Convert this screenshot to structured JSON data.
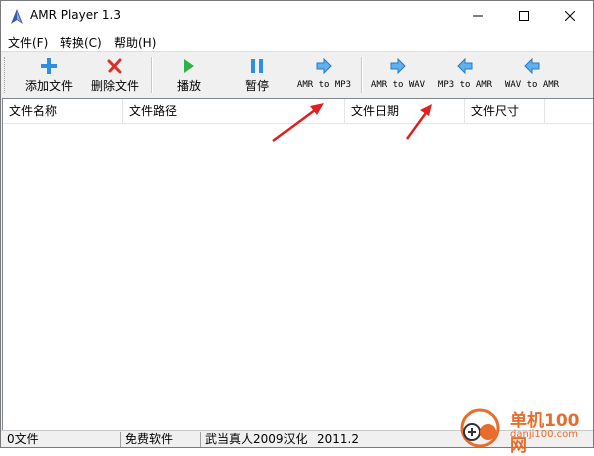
{
  "window": {
    "title": "AMR Player 1.3"
  },
  "menu": [
    {
      "label": "文件(F)"
    },
    {
      "label": "转换(C)"
    },
    {
      "label": "帮助(H)"
    }
  ],
  "toolbar": {
    "add": "添加文件",
    "delete": "删除文件",
    "play": "播放",
    "pause": "暂停",
    "amr_to_mp3": "AMR to MP3",
    "amr_to_wav": "AMR to WAV",
    "mp3_to_amr": "MP3 to AMR",
    "wav_to_amr": "WAV to AMR"
  },
  "columns": [
    "文件名称",
    "文件路径",
    "文件日期",
    "文件尺寸"
  ],
  "files": [],
  "status": {
    "count": "0文件",
    "license": "免费软件",
    "credit": "武当真人2009汉化",
    "version": "2011.2"
  },
  "watermark": {
    "brand": "单机100网",
    "domain": "danji100.com"
  },
  "colors": {
    "annotation_arrow": "#e02020",
    "watermark": "#e86c2b",
    "icon_blue": "#2f8de4",
    "icon_green": "#2bb34a",
    "icon_red": "#d9302a"
  },
  "icons": [
    "app-icon",
    "minimize-icon",
    "maximize-icon",
    "close-icon",
    "plus-icon",
    "delete-x-icon",
    "play-icon",
    "pause-icon",
    "arrow-right-icon",
    "arrow-left-icon"
  ]
}
